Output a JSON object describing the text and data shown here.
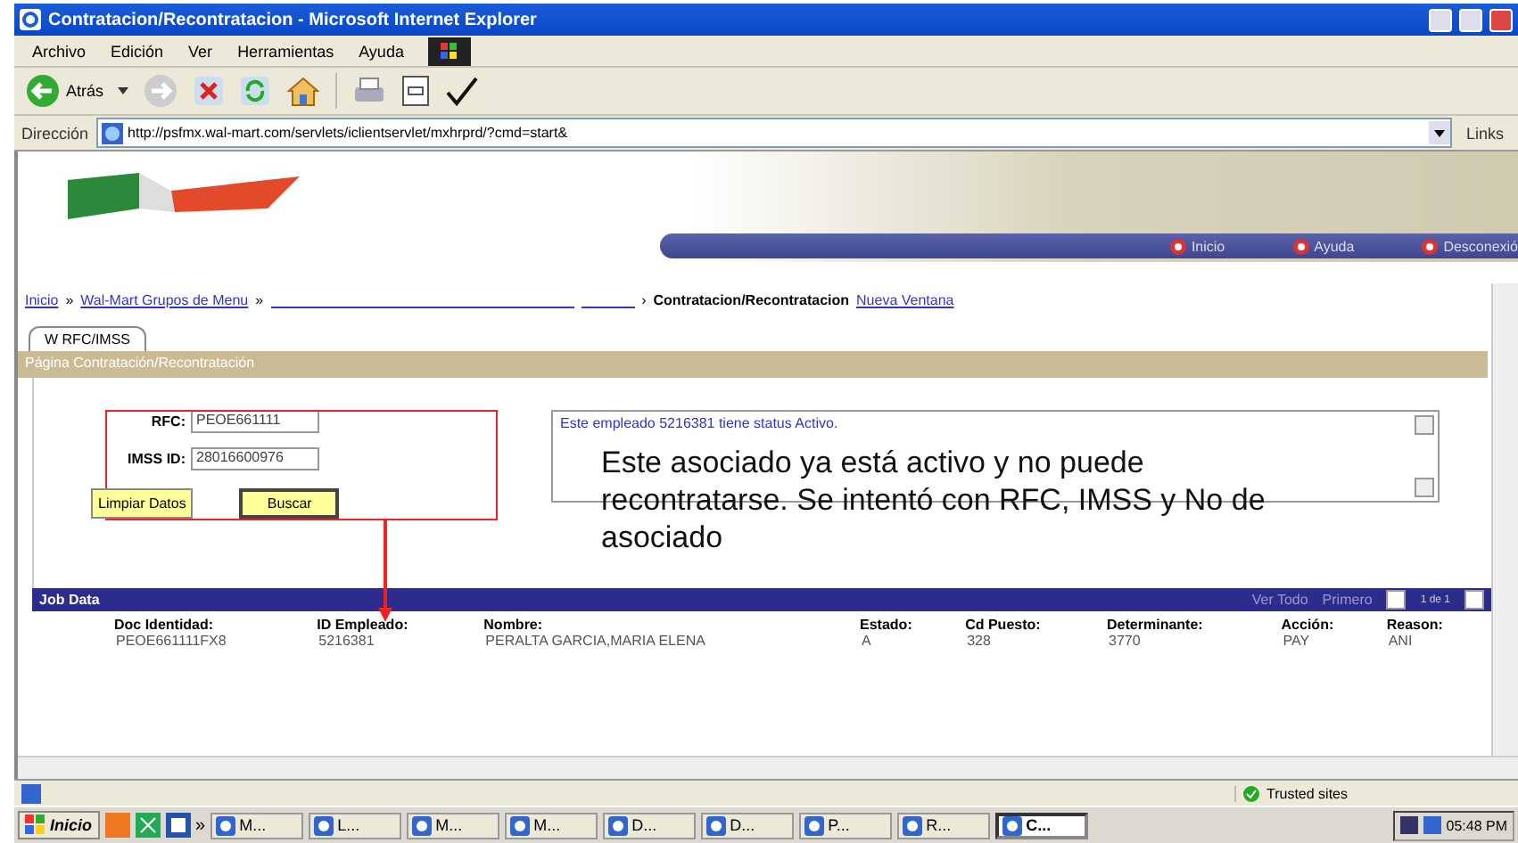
{
  "window": {
    "title": "Contratacion/Recontratacion - Microsoft Internet Explorer"
  },
  "menu": [
    "Archivo",
    "Edición",
    "Ver",
    "Herramientas",
    "Ayuda"
  ],
  "toolbar": {
    "back_label": "Atrás"
  },
  "address_bar": {
    "label": "Dirección",
    "url": "http://psfmx.wal-mart.com/servlets/iclientservlet/mxhrprd/?cmd=start&",
    "links": "Links"
  },
  "header_nav": [
    "Inicio",
    "Ayuda",
    "Desconexió"
  ],
  "breadcrumb": [
    {
      "kind": "link",
      "text": "Inicio"
    },
    {
      "kind": "sep",
      "text": "»"
    },
    {
      "kind": "link",
      "text": "Wal-Mart Grupos de Menu"
    },
    {
      "kind": "sep",
      "text": "»"
    },
    {
      "kind": "blank"
    },
    {
      "kind": "blank"
    },
    {
      "kind": "sep",
      "text": "›"
    },
    {
      "kind": "current",
      "text": "Contratacion/Recontratacion"
    },
    {
      "kind": "link",
      "text": "Nueva Ventana"
    }
  ],
  "tabs": [
    {
      "label": "W RFC/IMSS",
      "selected": true
    }
  ],
  "section_title": "Página Contratación/Recontratación",
  "form": {
    "fields": [
      {
        "label": "RFC:",
        "value": "PEOE661111"
      },
      {
        "label": "IMSS ID:",
        "value": "28016600976"
      }
    ],
    "buttons": [
      "Limpiar Datos",
      "Buscar"
    ]
  },
  "message": "Este empleado 5216381 tiene status Activo.",
  "annotation": "Este asociado ya está activo y no puede recontratarse.  Se intentó con RFC, IMSS y No de asociado",
  "job_data": {
    "title": "Job Data",
    "view_all": "Ver Todo",
    "first": "Primero",
    "range": "1 de 1",
    "columns": [
      "Doc Identidad:",
      "ID Empleado:",
      "Nombre:",
      "Estado:",
      "Cd Puesto:",
      "Determinante:",
      "Acción:",
      "Reason:"
    ],
    "rows": [
      [
        "PEOE661111FX8",
        "5216381",
        "PERALTA GARCIA,MARIA ELENA",
        "A",
        "328",
        "3770",
        "PAY",
        "ANI"
      ]
    ]
  },
  "status_bar": {
    "zone": "Trusted sites"
  },
  "taskbar": {
    "start": "Inicio",
    "more": "»",
    "buttons": [
      {
        "label": "M...",
        "selected": false
      },
      {
        "label": "L...",
        "selected": false
      },
      {
        "label": "M...",
        "selected": false
      },
      {
        "label": "M...",
        "selected": false
      },
      {
        "label": "D...",
        "selected": false
      },
      {
        "label": "D...",
        "selected": false
      },
      {
        "label": "P...",
        "selected": false
      },
      {
        "label": "R...",
        "selected": false
      },
      {
        "label": "C...",
        "selected": true
      }
    ],
    "clock": "05:48 PM"
  }
}
